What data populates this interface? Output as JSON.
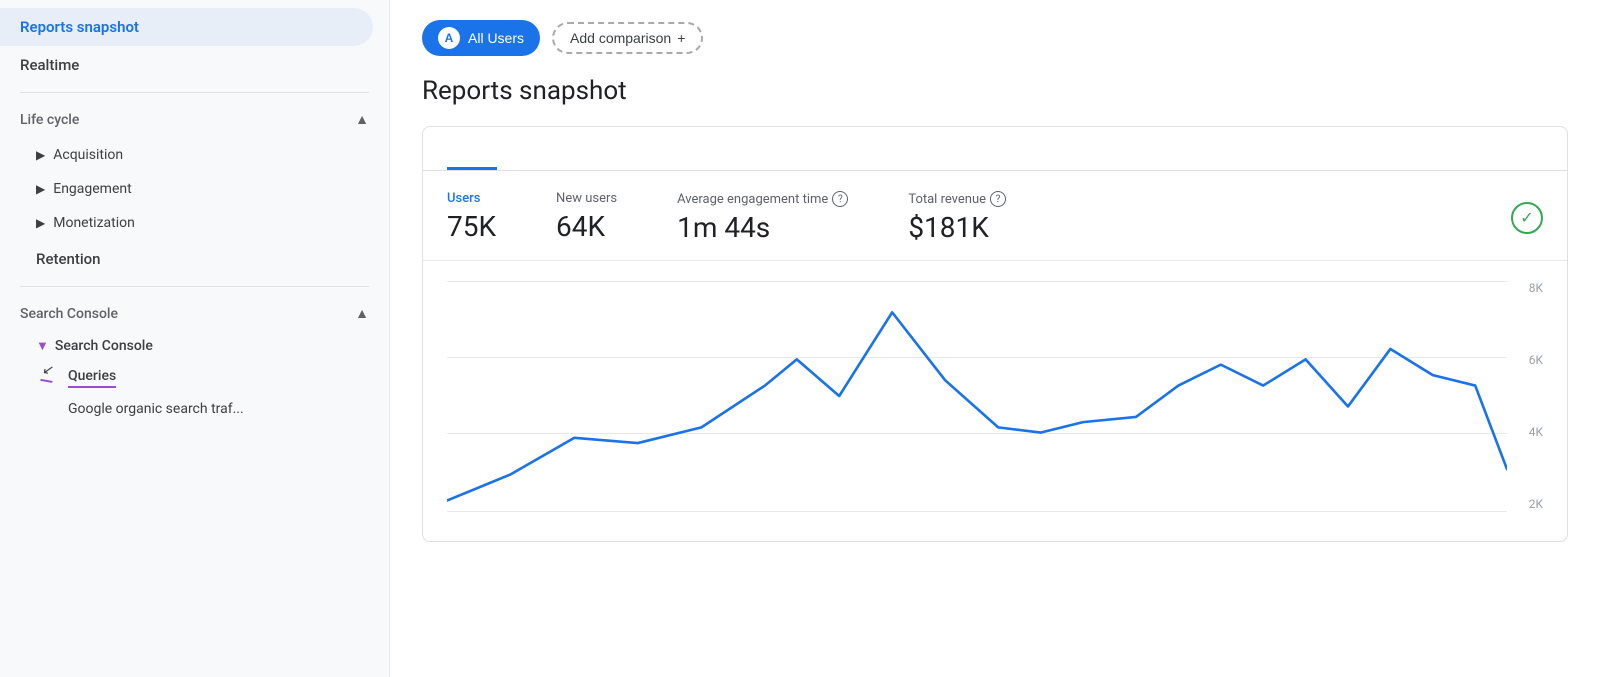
{
  "sidebar": {
    "active_item": "Reports snapshot",
    "realtime_label": "Realtime",
    "lifecycle_label": "Life cycle",
    "acquisition_label": "Acquisition",
    "engagement_label": "Engagement",
    "monetization_label": "Monetization",
    "retention_label": "Retention",
    "search_console_section_label": "Search Console",
    "search_console_nav_label": "Search Console",
    "queries_label": "Queries",
    "google_organic_label": "Google organic search traf..."
  },
  "header": {
    "all_users_label": "All Users",
    "all_users_avatar": "A",
    "add_comparison_label": "Add comparison",
    "add_icon": "+"
  },
  "main": {
    "page_title": "Reports snapshot",
    "tab_label": ""
  },
  "metrics": {
    "users_label": "Users",
    "users_value": "75K",
    "new_users_label": "New users",
    "new_users_value": "64K",
    "avg_engagement_label": "Average engagement time",
    "avg_engagement_value": "1m 44s",
    "total_revenue_label": "Total revenue",
    "total_revenue_value": "$181K"
  },
  "chart": {
    "y_labels": [
      "8K",
      "6K",
      "4K",
      "2K"
    ],
    "accent_color": "#1a73e8"
  }
}
